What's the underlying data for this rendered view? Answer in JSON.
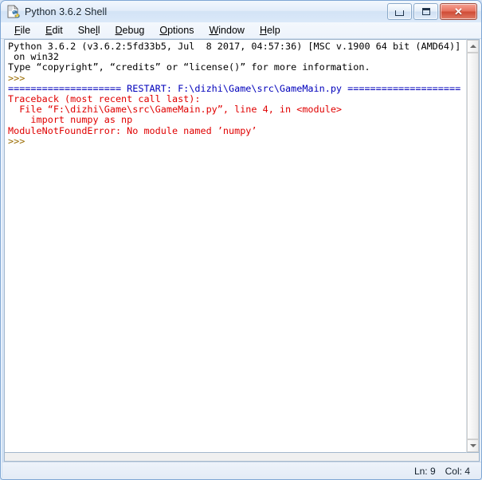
{
  "window": {
    "title": "Python 3.6.2 Shell",
    "icon": "python-idle-icon",
    "controls": {
      "minimize_label": "Minimize",
      "maximize_label": "Maximize",
      "close_label": "✕"
    }
  },
  "menubar": {
    "items": [
      {
        "label": "File",
        "accel": "F"
      },
      {
        "label": "Edit",
        "accel": "E"
      },
      {
        "label": "Shell",
        "accel": "l"
      },
      {
        "label": "Debug",
        "accel": "D"
      },
      {
        "label": "Options",
        "accel": "O"
      },
      {
        "label": "Window",
        "accel": "W"
      },
      {
        "label": "Help",
        "accel": "H"
      }
    ]
  },
  "console": {
    "lines": [
      {
        "text": "Python 3.6.2 (v3.6.2:5fd33b5, Jul  8 2017, 04:57:36) [MSC v.1900 64 bit (AMD64)]",
        "color": "black"
      },
      {
        "text": " on win32",
        "color": "black"
      },
      {
        "text": "Type “copyright”, “credits” or “license()” for more information.",
        "color": "black"
      },
      {
        "text": ">>> ",
        "color": "prompt"
      },
      {
        "text": "==================== RESTART: F:\\dizhi\\Game\\src\\GameMain.py ====================",
        "color": "restart"
      },
      {
        "text": "Traceback (most recent call last):",
        "color": "error"
      },
      {
        "text": "  File “F:\\dizhi\\Game\\src\\GameMain.py”, line 4, in <module>",
        "color": "error"
      },
      {
        "text": "    import numpy as np",
        "color": "error"
      },
      {
        "text": "ModuleNotFoundError: No module named ’numpy’",
        "color": "error"
      },
      {
        "text": ">>> ",
        "color": "prompt"
      }
    ]
  },
  "scrollbar": {
    "up_arrow": "scroll-up-arrow",
    "down_arrow": "scroll-down-arrow"
  },
  "statusbar": {
    "line_label": "Ln: 9",
    "col_label": "Col: 4"
  },
  "colors": {
    "prompt": "#9a6c00",
    "restart": "#0000bb",
    "error": "#e00000",
    "text": "#000000",
    "window_border": "#7ea6d4",
    "close_button": "#cf4a35"
  }
}
